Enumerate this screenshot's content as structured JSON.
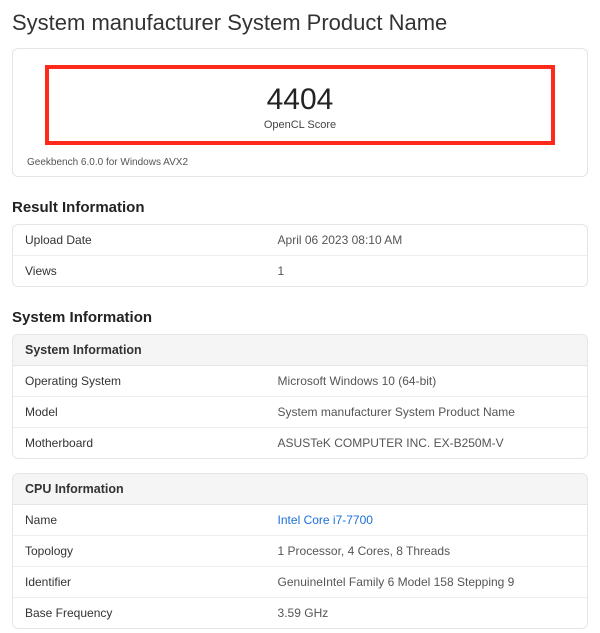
{
  "title": "System manufacturer System Product Name",
  "score": {
    "value": "4404",
    "label": "OpenCL Score",
    "footer": "Geekbench 6.0.0 for Windows AVX2"
  },
  "result_info": {
    "heading": "Result Information",
    "rows": [
      {
        "key": "Upload Date",
        "val": "April 06 2023 08:10 AM"
      },
      {
        "key": "Views",
        "val": "1"
      }
    ]
  },
  "system_info": {
    "heading": "System Information",
    "card_title": "System Information",
    "rows": [
      {
        "key": "Operating System",
        "val": "Microsoft Windows 10 (64-bit)"
      },
      {
        "key": "Model",
        "val": "System manufacturer System Product Name"
      },
      {
        "key": "Motherboard",
        "val": "ASUSTeK COMPUTER INC. EX-B250M-V"
      }
    ]
  },
  "cpu_info": {
    "card_title": "CPU Information",
    "rows": [
      {
        "key": "Name",
        "val": "Intel Core i7-7700",
        "link": true
      },
      {
        "key": "Topology",
        "val": "1 Processor, 4 Cores, 8 Threads"
      },
      {
        "key": "Identifier",
        "val": "GenuineIntel Family 6 Model 158 Stepping 9"
      },
      {
        "key": "Base Frequency",
        "val": "3.59 GHz"
      }
    ]
  }
}
